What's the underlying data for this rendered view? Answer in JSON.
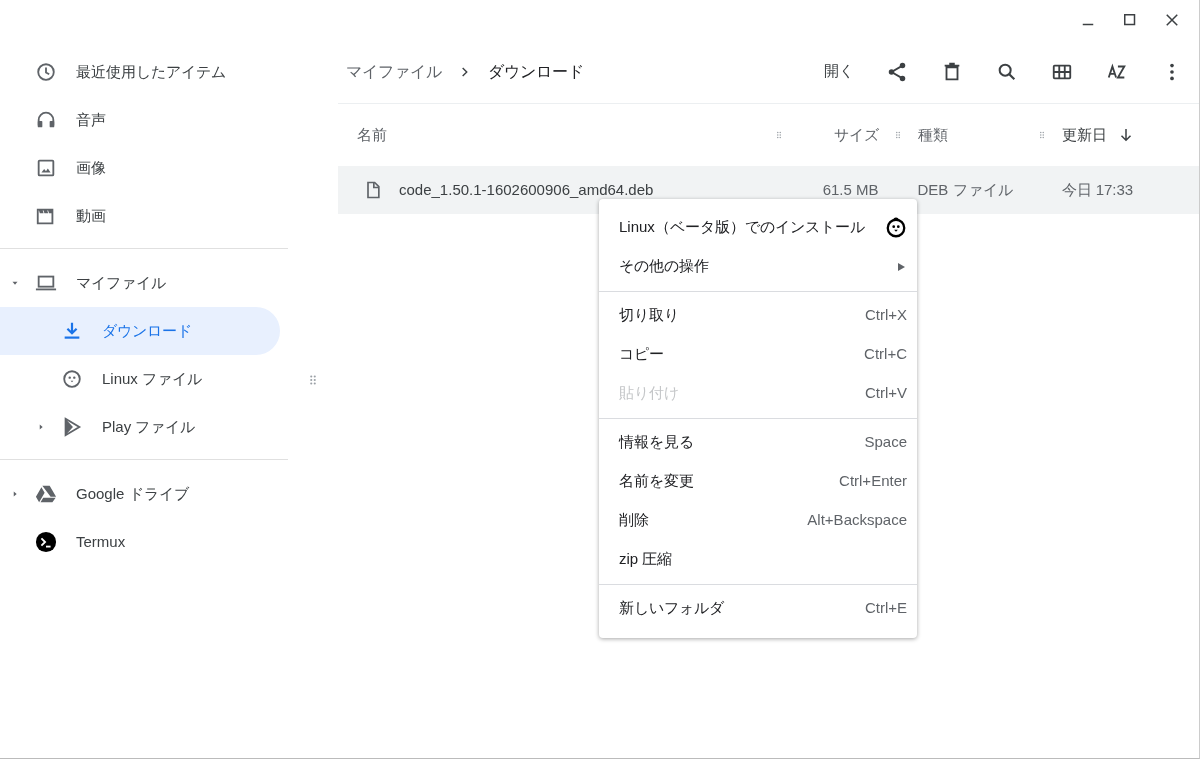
{
  "sidebar": {
    "sections": [
      {
        "items": [
          {
            "kind": "recent",
            "label": "最近使用したアイテム",
            "selected": false
          },
          {
            "kind": "audio",
            "label": "音声",
            "selected": false
          },
          {
            "kind": "image",
            "label": "画像",
            "selected": false
          },
          {
            "kind": "video",
            "label": "動画",
            "selected": false
          }
        ]
      },
      {
        "items": [
          {
            "kind": "computer",
            "label": "マイファイル",
            "selected": false,
            "expanded": true,
            "children": [
              {
                "kind": "download",
                "label": "ダウンロード",
                "selected": true
              },
              {
                "kind": "linux",
                "label": "Linux ファイル",
                "selected": false
              },
              {
                "kind": "play",
                "label": "Play ファイル",
                "selected": false,
                "expanded": false
              }
            ]
          }
        ]
      },
      {
        "items": [
          {
            "kind": "drive",
            "label": "Google ドライブ",
            "selected": false,
            "expanded": false
          },
          {
            "kind": "terminal",
            "label": "Termux",
            "selected": false
          }
        ]
      }
    ]
  },
  "breadcrumb": [
    "マイファイル",
    "ダウンロード"
  ],
  "toolbar": {
    "open_label": "開く"
  },
  "table": {
    "columns": [
      {
        "label": "名前",
        "sorted": false
      },
      {
        "label": "サイズ",
        "sorted": false
      },
      {
        "label": "種類",
        "sorted": false
      },
      {
        "label": "更新日",
        "sorted": true
      }
    ],
    "rows": [
      {
        "name": "code_1.50.1-1602600906_amd64.deb",
        "size": "61.5 MB",
        "type": "DEB ファイル",
        "modified": "今日 17:33",
        "selected": true
      }
    ]
  },
  "context_menu": {
    "groups": [
      {
        "items": [
          {
            "kind": "linux",
            "label": "Linux（ベータ版）でのインストール",
            "disabled": false
          },
          {
            "kind": "submenu",
            "label": "その他の操作",
            "disabled": false
          }
        ]
      },
      {
        "items": [
          {
            "kind": "plain",
            "label": "切り取り",
            "shortcut": "Ctrl+X",
            "disabled": false
          },
          {
            "kind": "plain",
            "label": "コピー",
            "shortcut": "Ctrl+C",
            "disabled": false
          },
          {
            "kind": "plain",
            "label": "貼り付け",
            "shortcut": "Ctrl+V",
            "disabled": true
          }
        ]
      },
      {
        "items": [
          {
            "kind": "plain",
            "label": "情報を見る",
            "shortcut": "Space",
            "disabled": false
          },
          {
            "kind": "plain",
            "label": "名前を変更",
            "shortcut": "Ctrl+Enter",
            "disabled": false
          },
          {
            "kind": "plain",
            "label": "削除",
            "shortcut": "Alt+Backspace",
            "disabled": false
          },
          {
            "kind": "plain",
            "label": "zip 圧縮",
            "disabled": false
          }
        ]
      },
      {
        "items": [
          {
            "kind": "plain",
            "label": "新しいフォルダ",
            "shortcut": "Ctrl+E",
            "disabled": false
          }
        ]
      }
    ]
  }
}
